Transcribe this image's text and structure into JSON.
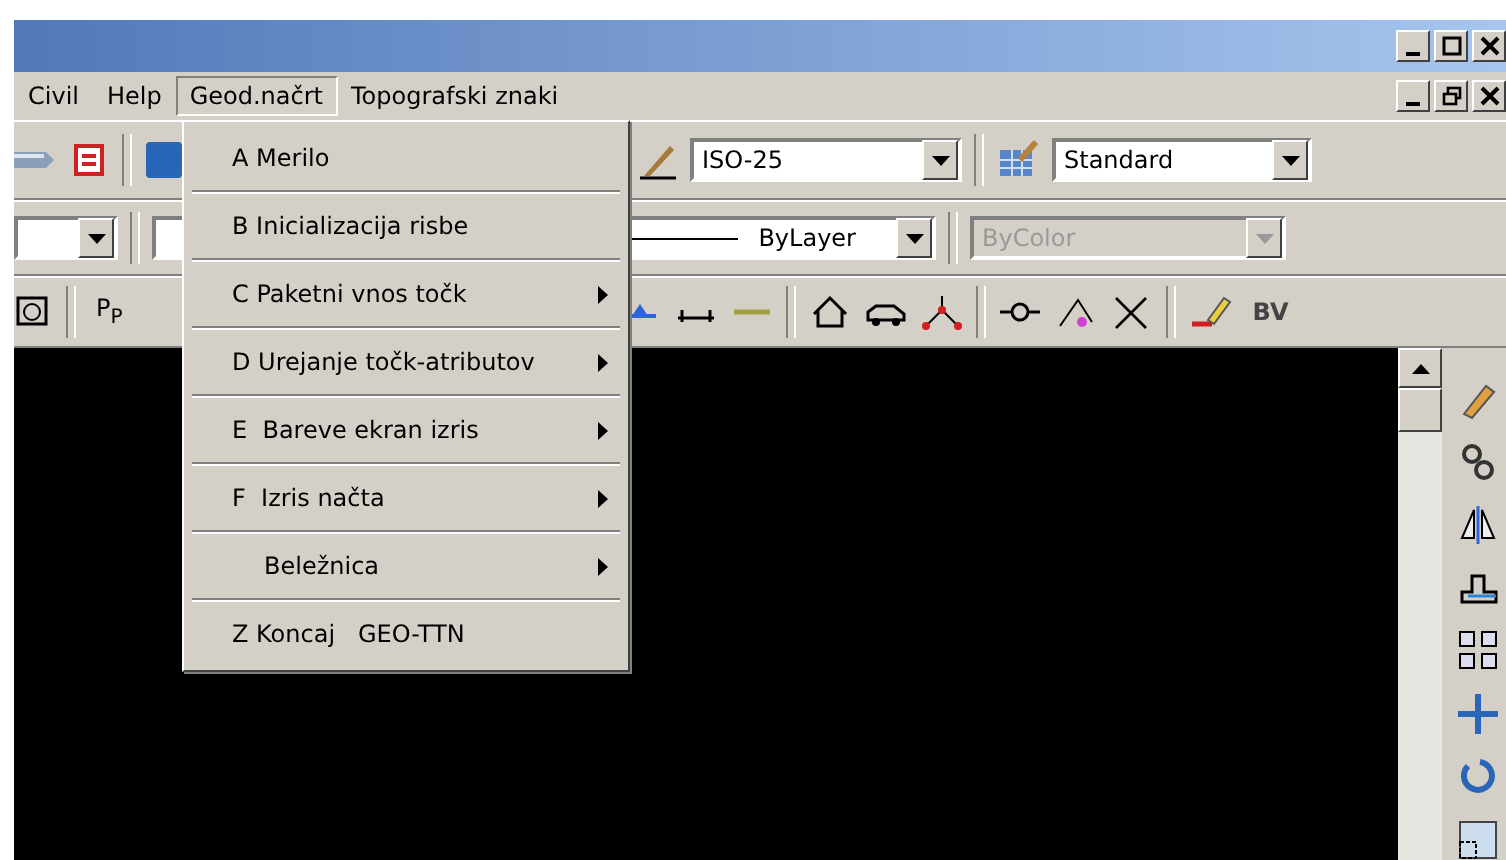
{
  "menu_bar": [
    {
      "label": "Civil",
      "selected": false
    },
    {
      "label": "Help",
      "selected": false
    },
    {
      "label": "Geod.načrt",
      "selected": true
    },
    {
      "label": "Topografski znaki",
      "selected": false
    }
  ],
  "dropdown": [
    {
      "label": "A Merilo",
      "submenu": false,
      "indented": false
    },
    {
      "label": "B Inicializacija risbe",
      "submenu": false,
      "indented": false
    },
    {
      "label": "C Paketni vnos točk",
      "submenu": true,
      "indented": false
    },
    {
      "label": "D Urejanje točk-atributov",
      "submenu": true,
      "indented": false
    },
    {
      "label": "E  Bareve ekran izris",
      "submenu": true,
      "indented": false
    },
    {
      "label": "F  Izris načta",
      "submenu": true,
      "indented": false
    },
    {
      "label": "Beležnica",
      "submenu": true,
      "indented": true
    },
    {
      "label": "Z Koncaj   GEO-TTN",
      "submenu": false,
      "indented": false
    }
  ],
  "toolbar": {
    "dim_style": "ISO-25",
    "table_style": "Standard",
    "linetype": "ByLayer",
    "plot_style": {
      "value": "ByColor",
      "disabled": true
    },
    "points_button": "P$_{P}$",
    "bv_button": "BV"
  }
}
